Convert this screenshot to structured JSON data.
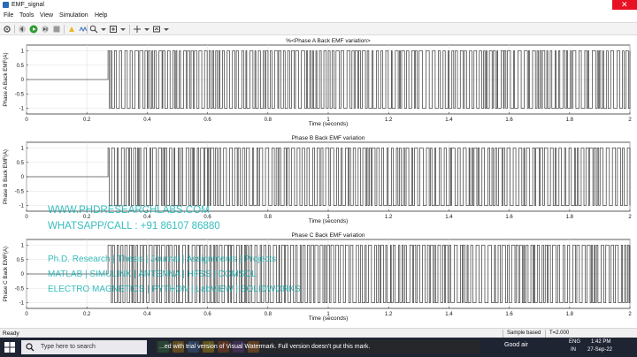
{
  "window": {
    "title": "EMF_signal",
    "close_label": "✕"
  },
  "menu": {
    "items": [
      "File",
      "Tools",
      "View",
      "Simulation",
      "Help"
    ]
  },
  "toolbar": {
    "icons": [
      "gear-icon",
      "back-icon",
      "run-icon",
      "stop-icon",
      "step-icon",
      "highlight-icon",
      "zoom-icon",
      "fit-icon",
      "cursor-icon",
      "measure-icon",
      "triggers-icon",
      "write-icon"
    ]
  },
  "chart_data": [
    {
      "type": "line",
      "title": "%<Phase A Back EMF variation>",
      "xlabel": "Time (seconds)",
      "ylabel": "Phase A Back EMF(A)",
      "xlim": [
        0,
        2
      ],
      "ylim": [
        -1.2,
        1.2
      ],
      "x_ticks": [
        "0",
        "0.2",
        "0.4",
        "0.6",
        "0.8",
        "1",
        "1.2",
        "1.4",
        "1.6",
        "1.8",
        "2"
      ],
      "y_ticks": [
        "1",
        "0.5",
        "0",
        "-0.5",
        "-1"
      ],
      "grid": true,
      "series": [
        {
          "signal": "square pulse train switching between +1 and -1, constant 0 before switching starts",
          "switching_start": 0.27,
          "levels": [
            1,
            0,
            -1
          ],
          "color": "#000000"
        }
      ]
    },
    {
      "type": "line",
      "title": "Phase B Back EMF variation",
      "xlabel": "Time (seconds)",
      "ylabel": "Phase B Back EMF(A)",
      "xlim": [
        0,
        2
      ],
      "ylim": [
        -1.2,
        1.2
      ],
      "x_ticks": [
        "0",
        "0.2",
        "0.4",
        "0.6",
        "0.8",
        "1",
        "1.2",
        "1.4",
        "1.6",
        "1.8",
        "2"
      ],
      "y_ticks": [
        "1",
        "0.5",
        "0",
        "-0.5",
        "-1"
      ],
      "grid": true,
      "series": [
        {
          "signal": "square pulse train switching between +1 and -1, constant 0 before switching starts",
          "switching_start": 0.27,
          "levels": [
            1,
            0,
            -1
          ],
          "color": "#000000"
        }
      ]
    },
    {
      "type": "line",
      "title": "Phase C Back EMF variation",
      "xlabel": "Time (seconds)",
      "ylabel": "Phase C Back EMF(A)",
      "xlim": [
        0,
        2
      ],
      "ylim": [
        -1.2,
        1.2
      ],
      "x_ticks": [
        "0",
        "0.2",
        "0.4",
        "0.6",
        "0.8",
        "1",
        "1.2",
        "1.4",
        "1.6",
        "1.8",
        "2"
      ],
      "y_ticks": [
        "1",
        "0.5",
        "0",
        "-0.5",
        "-1"
      ],
      "grid": true,
      "series": [
        {
          "signal": "square pulse train switching between +1 and -1, constant 0 before switching starts",
          "switching_start": 0.27,
          "levels": [
            1,
            0,
            -1
          ],
          "color": "#000000"
        }
      ]
    }
  ],
  "watermark": {
    "line1": "WWW.PHDRESEARCHLABS.COM",
    "line2": "WHATSAPP/CALL : +91 86107 86880",
    "line3": "Ph.D. Research | Thesis | Journal | Assignments | Projects",
    "line4": "MATLAB | SIMULINK | ANTENNA | HFSS | COMSOL",
    "line5": "ELECTRO MAGNETICS | PYTHON | LabVIEW | SOLIDWORKS",
    "color": "#00aaaa"
  },
  "status": {
    "left": "Ready",
    "sample": "Sample based",
    "time": "T=2.000"
  },
  "taskbar": {
    "search_placeholder": "Type here to search",
    "banner": "...ed with trial version of Visual Watermark. Full version doesn't put this mark.",
    "weather": "Good air",
    "lang": "ENG",
    "region": "IN",
    "clock_time": "1:42 PM",
    "clock_date": "27-Sep-22",
    "icon_colors": [
      "#2e8b57",
      "#f0a30a",
      "#3c7be0",
      "#f5c400",
      "#d94f1f",
      "#7b3fbf",
      "#f07a1a"
    ]
  }
}
